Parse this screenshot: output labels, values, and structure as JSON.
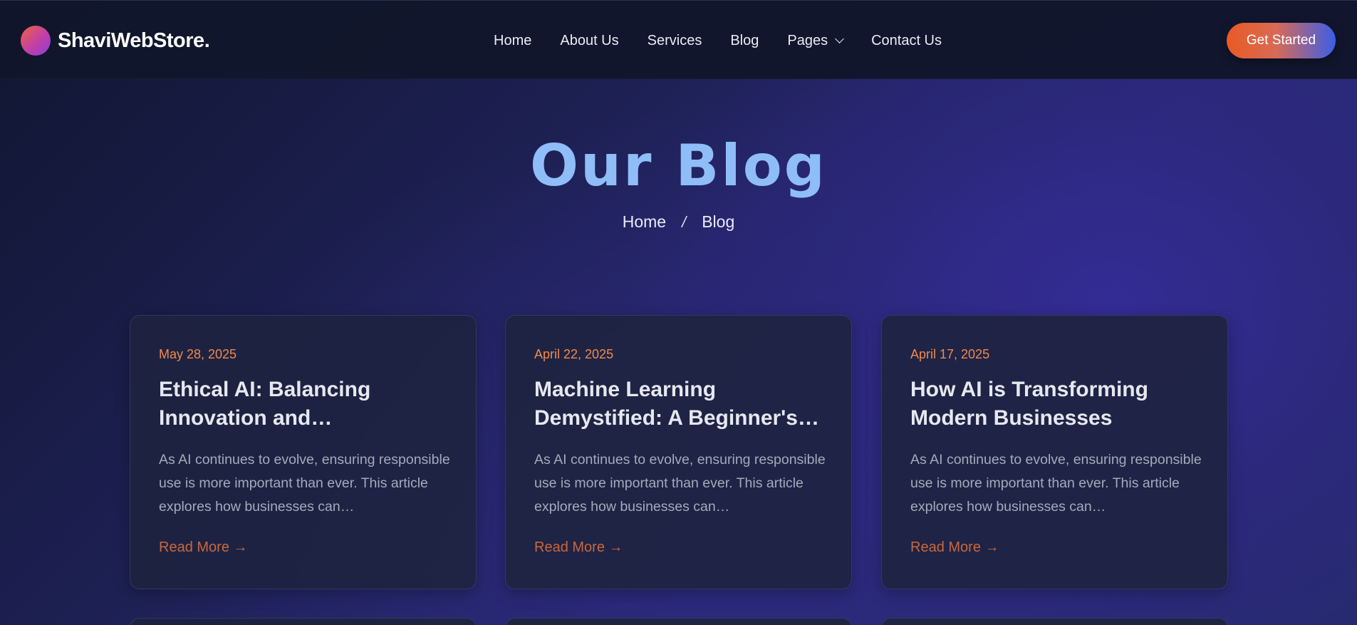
{
  "header": {
    "brand": "ShaviWebStore.",
    "nav": [
      "Home",
      "About Us",
      "Services",
      "Blog",
      "Pages",
      "Contact Us"
    ],
    "cta_label": "Get Started"
  },
  "hero": {
    "title": "Our Blog",
    "breadcrumb": {
      "home": "Home",
      "separator": "/",
      "current": "Blog"
    }
  },
  "posts": [
    {
      "date": "May 28, 2025",
      "title": "Ethical AI: Balancing Innovation and…",
      "excerpt": "As AI continues to evolve, ensuring responsible use is more important than ever. This article explores how businesses can…",
      "link": "Read More →"
    },
    {
      "date": "April 22, 2025",
      "title": "Machine Learning Demystified: A Beginner's…",
      "excerpt": "As AI continues to evolve, ensuring responsible use is more important than ever. This article explores how businesses can…",
      "link": "Read More →"
    },
    {
      "date": "April 17, 2025",
      "title": "How AI is Transforming Modern Businesses",
      "excerpt": "As AI continues to evolve, ensuring responsible use is more important than ever. This article explores how businesses can…",
      "link": "Read More →"
    }
  ],
  "colors": {
    "accent_orange": "#f08a4b",
    "hero_title": "#8fbdf7",
    "cta_start": "#ea5a25",
    "cta_end": "#3b5ee8"
  },
  "icons": {
    "logo": "gradient-circle-logo",
    "dropdown": "chevron-down-icon"
  }
}
